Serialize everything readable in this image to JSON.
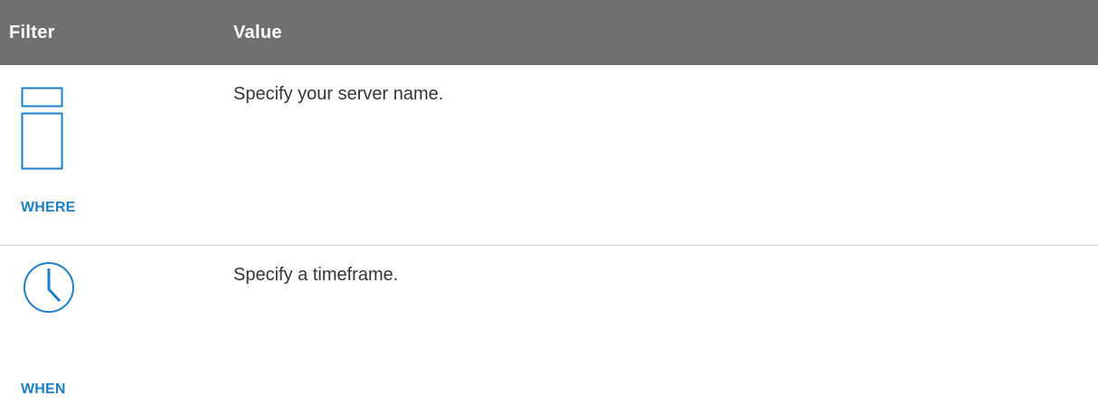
{
  "table": {
    "header": {
      "filter": "Filter",
      "value": "Value"
    },
    "rows": [
      {
        "icon": "server-icon",
        "label": "WHERE",
        "value": "Specify your server name."
      },
      {
        "icon": "clock-icon",
        "label": "WHEN",
        "value": "Specify a timeframe."
      }
    ]
  },
  "colors": {
    "header_bg": "#707070",
    "header_text": "#ffffff",
    "accent_blue": "#1f7fc4",
    "body_text": "#333333",
    "divider": "#cfcfcf"
  }
}
